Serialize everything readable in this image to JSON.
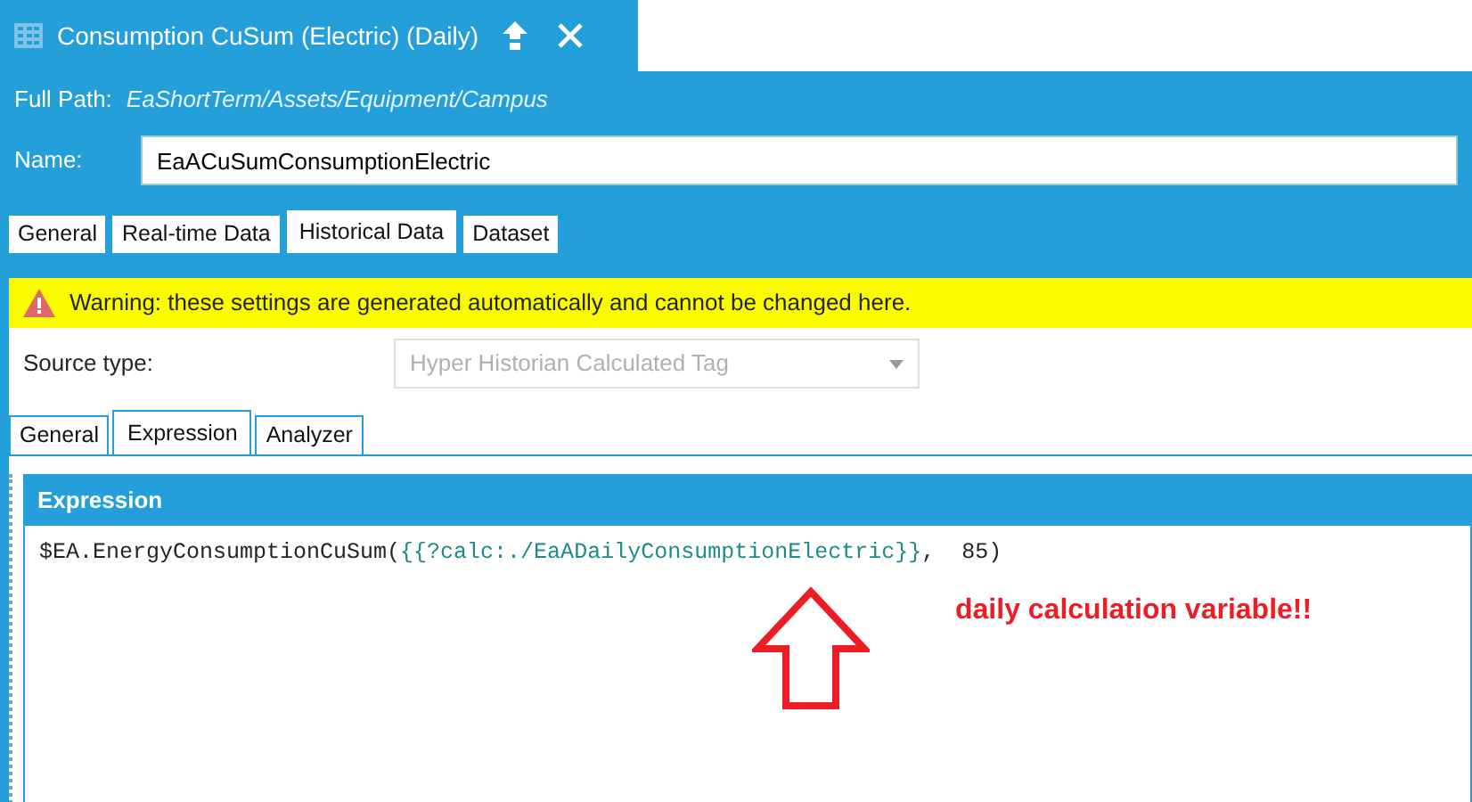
{
  "window": {
    "title": "Consumption CuSum (Electric) (Daily)"
  },
  "full_path": {
    "label": "Full Path:",
    "value": "EaShortTerm/Assets/Equipment/Campus"
  },
  "name": {
    "label": "Name:",
    "value": "EaACuSumConsumptionElectric"
  },
  "tabs": [
    {
      "label": "General",
      "selected": false
    },
    {
      "label": "Real-time Data",
      "selected": false
    },
    {
      "label": "Historical Data",
      "selected": true
    },
    {
      "label": "Dataset",
      "selected": false
    }
  ],
  "warning": "Warning: these settings are generated automatically and cannot be changed here.",
  "source_type": {
    "label": "Source type:",
    "value": "Hyper Historian Calculated Tag",
    "disabled": true
  },
  "sub_tabs": [
    {
      "label": "General",
      "selected": false
    },
    {
      "label": "Expression",
      "selected": true
    },
    {
      "label": "Analyzer",
      "selected": false
    }
  ],
  "expression": {
    "title": "Expression",
    "segments": [
      {
        "text": "$EA.EnergyConsumptionCuSum(",
        "kind": "plain"
      },
      {
        "text": "{{?calc:./EaADailyConsumptionElectric}}",
        "kind": "reference"
      },
      {
        "text": ",  85)",
        "kind": "plain"
      }
    ]
  },
  "annotation": {
    "text": "daily calculation variable!!"
  }
}
